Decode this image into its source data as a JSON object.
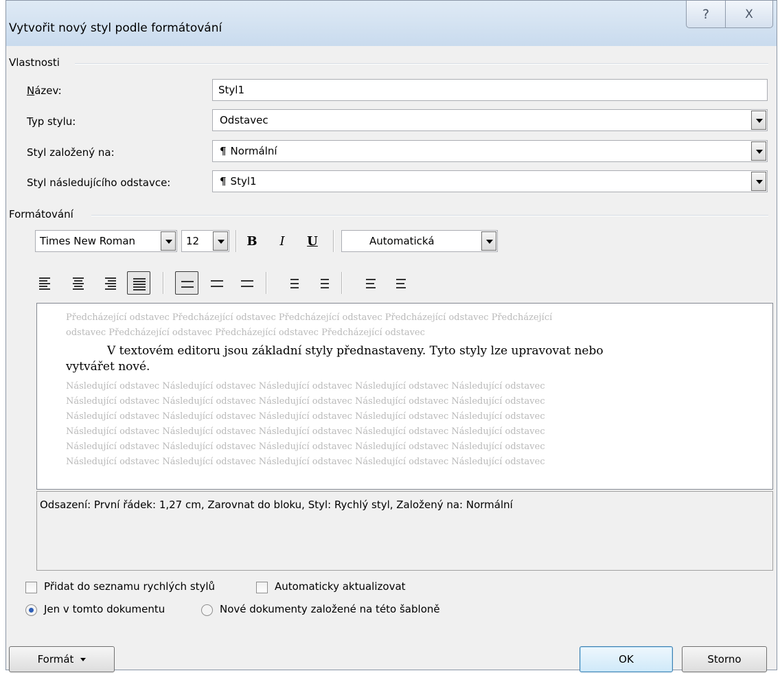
{
  "window": {
    "title": "Vytvořit nový styl podle formátování",
    "help_glyph": "?",
    "close_glyph": "X"
  },
  "properties": {
    "group_title": "Vlastnosti",
    "name_label": "Název:",
    "name_value": "Styl1",
    "type_label": "Typ stylu:",
    "type_value": "Odstavec",
    "based_on_label": "Styl založený na:",
    "based_on_value": "Normální",
    "next_label": "Styl následujícího odstavce:",
    "next_value": "Styl1",
    "pilcrow": "¶"
  },
  "formatting": {
    "group_title": "Formátování",
    "font": "Times New Roman",
    "size": "12",
    "bold": "B",
    "italic": "I",
    "underline": "U",
    "color": "Automatická"
  },
  "preview": {
    "previous_lines": [
      "Předcházející odstavec Předcházející odstavec Předcházející odstavec Předcházející odstavec Předcházející",
      "odstavec Předcházející odstavec Předcházející odstavec Předcházející odstavec"
    ],
    "current_line1": "V textovém editoru jsou základní styly přednastaveny. Tyto styly lze upravovat nebo",
    "current_line2": "vytvářet nové.",
    "following_lines": [
      "Následující odstavec Následující odstavec Následující odstavec Následující odstavec Následující odstavec",
      "Následující odstavec Následující odstavec Následující odstavec Následující odstavec Následující odstavec",
      "Následující odstavec Následující odstavec Následující odstavec Následující odstavec Následující odstavec",
      "Následující odstavec Následující odstavec Následující odstavec Následující odstavec Následující odstavec",
      "Následující odstavec Následující odstavec Následující odstavec Následující odstavec Následující odstavec",
      "Následující odstavec Následující odstavec Následující odstavec Následující odstavec Následující odstavec"
    ]
  },
  "description": "Odsazení: První řádek:  1,27 cm, Zarovnat do bloku, Styl: Rychlý styl, Založený na: Normální",
  "options": {
    "add_quick": "Přidat do seznamu rychlých stylů",
    "auto_update": "Automaticky aktualizovat",
    "only_doc": "Jen v tomto dokumentu",
    "new_docs": "Nové dokumenty založené na této šabloně"
  },
  "buttons": {
    "format": "Formát",
    "ok": "OK",
    "cancel": "Storno"
  }
}
